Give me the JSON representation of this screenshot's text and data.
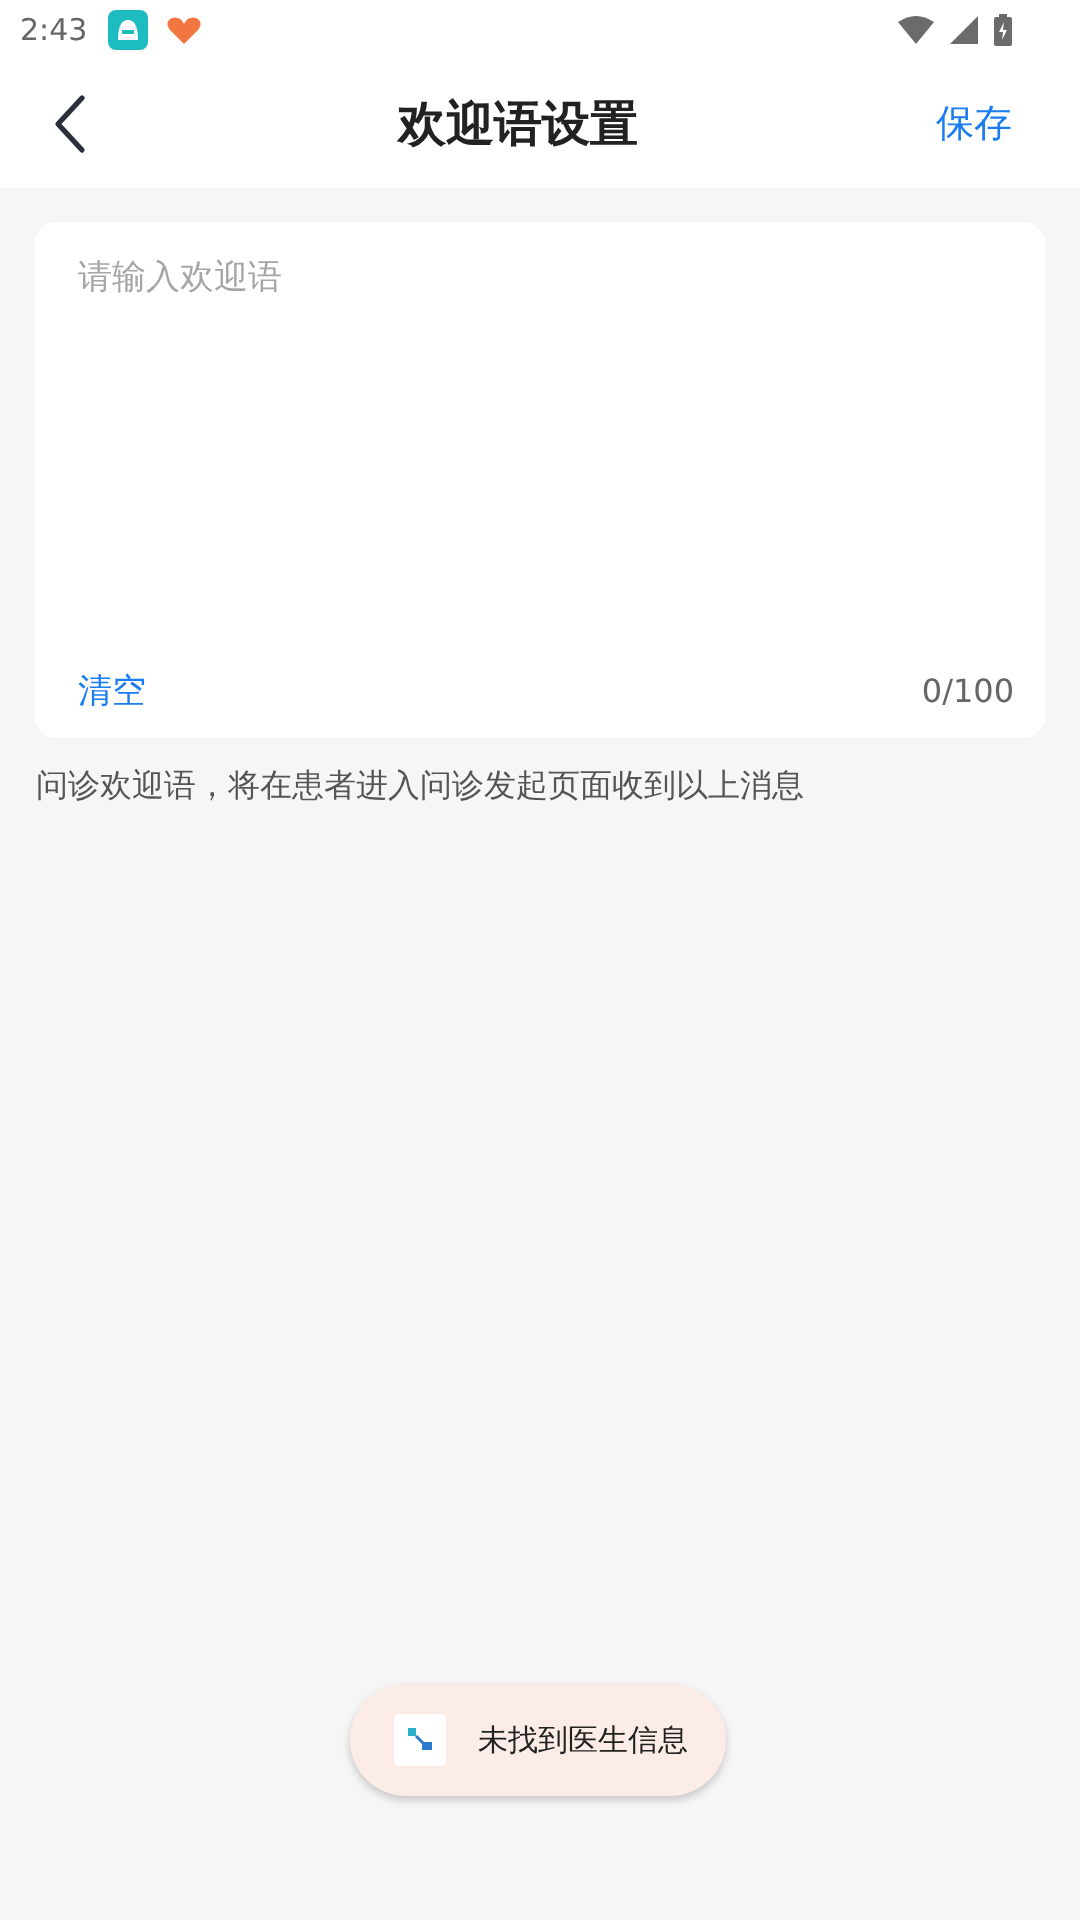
{
  "status_bar": {
    "time": "2:43"
  },
  "header": {
    "title": "欢迎语设置",
    "action": "保存"
  },
  "editor": {
    "placeholder": "请输入欢迎语",
    "clear": "清空",
    "counter": "0/100"
  },
  "note": "问诊欢迎语，将在患者进入问诊发起页面收到以上消息",
  "toast": {
    "text": "未找到医生信息"
  }
}
